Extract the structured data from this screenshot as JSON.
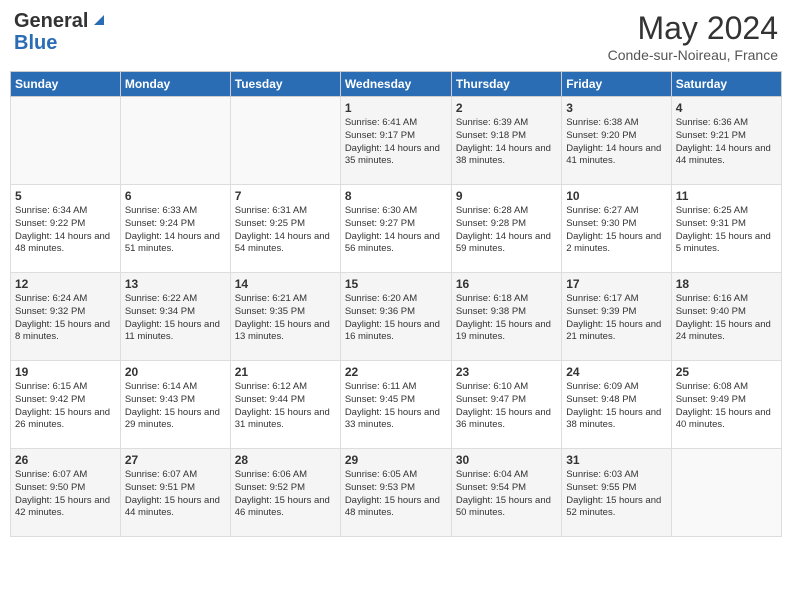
{
  "header": {
    "logo_general": "General",
    "logo_blue": "Blue",
    "month_year": "May 2024",
    "location": "Conde-sur-Noireau, France"
  },
  "days_of_week": [
    "Sunday",
    "Monday",
    "Tuesday",
    "Wednesday",
    "Thursday",
    "Friday",
    "Saturday"
  ],
  "weeks": [
    [
      {
        "day": "",
        "info": ""
      },
      {
        "day": "",
        "info": ""
      },
      {
        "day": "",
        "info": ""
      },
      {
        "day": "1",
        "info": "Sunrise: 6:41 AM\nSunset: 9:17 PM\nDaylight: 14 hours and 35 minutes."
      },
      {
        "day": "2",
        "info": "Sunrise: 6:39 AM\nSunset: 9:18 PM\nDaylight: 14 hours and 38 minutes."
      },
      {
        "day": "3",
        "info": "Sunrise: 6:38 AM\nSunset: 9:20 PM\nDaylight: 14 hours and 41 minutes."
      },
      {
        "day": "4",
        "info": "Sunrise: 6:36 AM\nSunset: 9:21 PM\nDaylight: 14 hours and 44 minutes."
      }
    ],
    [
      {
        "day": "5",
        "info": "Sunrise: 6:34 AM\nSunset: 9:22 PM\nDaylight: 14 hours and 48 minutes."
      },
      {
        "day": "6",
        "info": "Sunrise: 6:33 AM\nSunset: 9:24 PM\nDaylight: 14 hours and 51 minutes."
      },
      {
        "day": "7",
        "info": "Sunrise: 6:31 AM\nSunset: 9:25 PM\nDaylight: 14 hours and 54 minutes."
      },
      {
        "day": "8",
        "info": "Sunrise: 6:30 AM\nSunset: 9:27 PM\nDaylight: 14 hours and 56 minutes."
      },
      {
        "day": "9",
        "info": "Sunrise: 6:28 AM\nSunset: 9:28 PM\nDaylight: 14 hours and 59 minutes."
      },
      {
        "day": "10",
        "info": "Sunrise: 6:27 AM\nSunset: 9:30 PM\nDaylight: 15 hours and 2 minutes."
      },
      {
        "day": "11",
        "info": "Sunrise: 6:25 AM\nSunset: 9:31 PM\nDaylight: 15 hours and 5 minutes."
      }
    ],
    [
      {
        "day": "12",
        "info": "Sunrise: 6:24 AM\nSunset: 9:32 PM\nDaylight: 15 hours and 8 minutes."
      },
      {
        "day": "13",
        "info": "Sunrise: 6:22 AM\nSunset: 9:34 PM\nDaylight: 15 hours and 11 minutes."
      },
      {
        "day": "14",
        "info": "Sunrise: 6:21 AM\nSunset: 9:35 PM\nDaylight: 15 hours and 13 minutes."
      },
      {
        "day": "15",
        "info": "Sunrise: 6:20 AM\nSunset: 9:36 PM\nDaylight: 15 hours and 16 minutes."
      },
      {
        "day": "16",
        "info": "Sunrise: 6:18 AM\nSunset: 9:38 PM\nDaylight: 15 hours and 19 minutes."
      },
      {
        "day": "17",
        "info": "Sunrise: 6:17 AM\nSunset: 9:39 PM\nDaylight: 15 hours and 21 minutes."
      },
      {
        "day": "18",
        "info": "Sunrise: 6:16 AM\nSunset: 9:40 PM\nDaylight: 15 hours and 24 minutes."
      }
    ],
    [
      {
        "day": "19",
        "info": "Sunrise: 6:15 AM\nSunset: 9:42 PM\nDaylight: 15 hours and 26 minutes."
      },
      {
        "day": "20",
        "info": "Sunrise: 6:14 AM\nSunset: 9:43 PM\nDaylight: 15 hours and 29 minutes."
      },
      {
        "day": "21",
        "info": "Sunrise: 6:12 AM\nSunset: 9:44 PM\nDaylight: 15 hours and 31 minutes."
      },
      {
        "day": "22",
        "info": "Sunrise: 6:11 AM\nSunset: 9:45 PM\nDaylight: 15 hours and 33 minutes."
      },
      {
        "day": "23",
        "info": "Sunrise: 6:10 AM\nSunset: 9:47 PM\nDaylight: 15 hours and 36 minutes."
      },
      {
        "day": "24",
        "info": "Sunrise: 6:09 AM\nSunset: 9:48 PM\nDaylight: 15 hours and 38 minutes."
      },
      {
        "day": "25",
        "info": "Sunrise: 6:08 AM\nSunset: 9:49 PM\nDaylight: 15 hours and 40 minutes."
      }
    ],
    [
      {
        "day": "26",
        "info": "Sunrise: 6:07 AM\nSunset: 9:50 PM\nDaylight: 15 hours and 42 minutes."
      },
      {
        "day": "27",
        "info": "Sunrise: 6:07 AM\nSunset: 9:51 PM\nDaylight: 15 hours and 44 minutes."
      },
      {
        "day": "28",
        "info": "Sunrise: 6:06 AM\nSunset: 9:52 PM\nDaylight: 15 hours and 46 minutes."
      },
      {
        "day": "29",
        "info": "Sunrise: 6:05 AM\nSunset: 9:53 PM\nDaylight: 15 hours and 48 minutes."
      },
      {
        "day": "30",
        "info": "Sunrise: 6:04 AM\nSunset: 9:54 PM\nDaylight: 15 hours and 50 minutes."
      },
      {
        "day": "31",
        "info": "Sunrise: 6:03 AM\nSunset: 9:55 PM\nDaylight: 15 hours and 52 minutes."
      },
      {
        "day": "",
        "info": ""
      }
    ]
  ]
}
